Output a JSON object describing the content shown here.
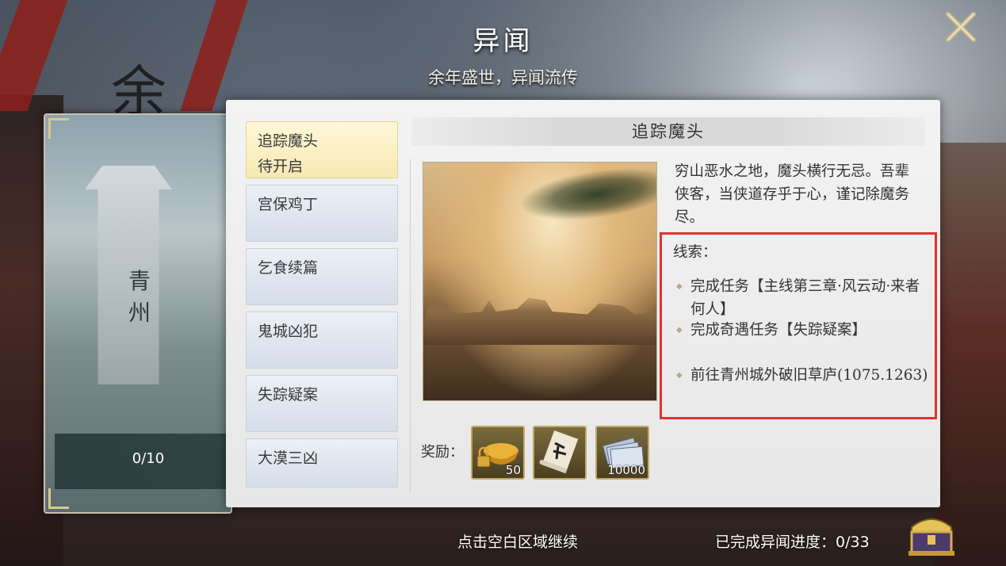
{
  "header": {
    "title": "异闻",
    "subtitle": "余年盛世，异闻流传"
  },
  "background_text": "余",
  "region": {
    "name": "青州",
    "progress": "0/10"
  },
  "events": [
    {
      "name": "追踪魔头",
      "status": "待开启",
      "active": true
    },
    {
      "name": "宫保鸡丁",
      "status": ""
    },
    {
      "name": "乞食续篇",
      "status": ""
    },
    {
      "name": "鬼城凶犯",
      "status": ""
    },
    {
      "name": "失踪疑案",
      "status": ""
    },
    {
      "name": "大漠三凶",
      "status": ""
    }
  ],
  "detail": {
    "title": "追踪魔头",
    "description": "穷山恶水之地，魔头横行无忌。吾辈侠客，当侠道存乎于心，谨记除魔务尽。",
    "clue_heading": "线索：",
    "clues": [
      "完成任务【主线第三章·风云动·来者何人】",
      "完成奇遇任务【失踪疑案】",
      "前往青州城外破旧草庐(1075.1263)"
    ],
    "reward_label": "奖励：",
    "rewards": [
      {
        "icon": "gold-ingot-locked-icon",
        "count": "50"
      },
      {
        "icon": "scroll-icon",
        "count": ""
      },
      {
        "icon": "silver-notes-icon",
        "count": "10000"
      }
    ]
  },
  "footer": {
    "hint": "点击空白区域继续",
    "progress_label": "已完成异闻进度：",
    "progress_value": "0/33"
  },
  "colors": {
    "highlight_box": "#e0322f",
    "active_item": "#f6e9b3",
    "panel": "#efefef"
  }
}
